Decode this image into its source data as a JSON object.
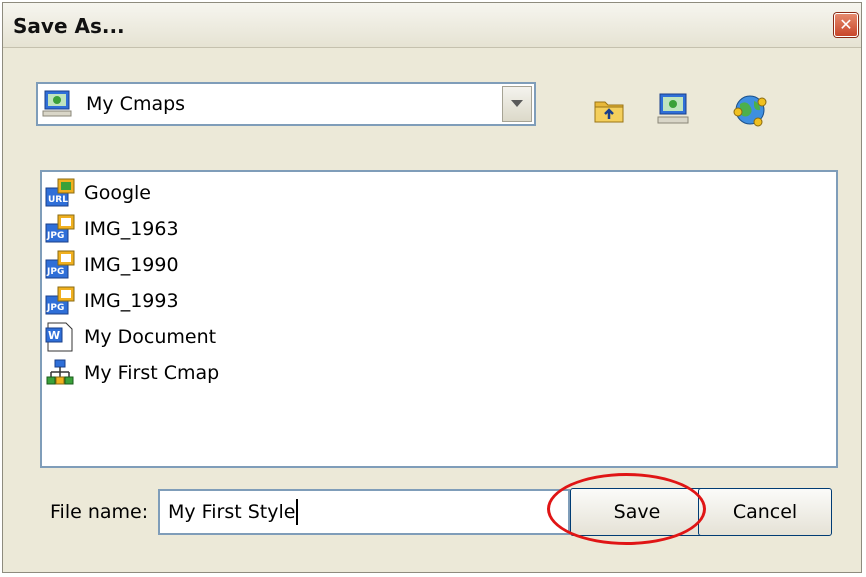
{
  "window": {
    "title": "Save As...",
    "close_glyph": "✕"
  },
  "location": {
    "selected": "My Cmaps",
    "icon": "cmaps-computer-icon"
  },
  "toolbar": {
    "buttons": [
      "up-folder-icon",
      "my-cmaps-icon",
      "shared-places-globe-icon"
    ]
  },
  "files": [
    {
      "name": "Google",
      "icon": "url-file-icon",
      "badge": "URL"
    },
    {
      "name": "IMG_1963",
      "icon": "jpg-file-icon",
      "badge": "JPG"
    },
    {
      "name": "IMG_1990",
      "icon": "jpg-file-icon",
      "badge": "JPG"
    },
    {
      "name": "IMG_1993",
      "icon": "jpg-file-icon",
      "badge": "JPG"
    },
    {
      "name": "My Document",
      "icon": "word-document-icon",
      "badge": "W"
    },
    {
      "name": "My First Cmap",
      "icon": "cmap-icon",
      "badge": ""
    }
  ],
  "filename": {
    "label": "File name:",
    "value": "My First Style"
  },
  "buttons": {
    "save": "Save",
    "cancel": "Cancel"
  },
  "colors": {
    "highlight": "#e01515",
    "dialog_bg": "#ece9d8",
    "field_border": "#7f9db9"
  }
}
